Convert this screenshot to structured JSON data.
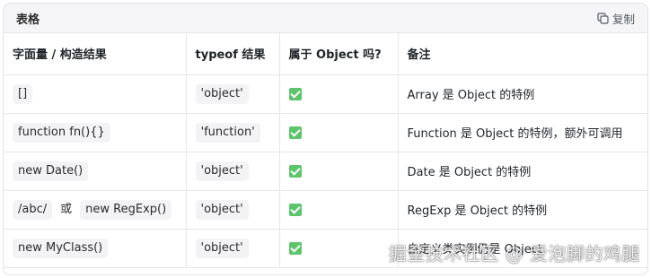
{
  "header": {
    "title": "表格",
    "copy_label": "复制",
    "copy_icon": "copy-icon"
  },
  "table": {
    "columns": [
      "字面量 / 构造结果",
      "typeof 结果",
      "属于 Object 吗?",
      "备注"
    ],
    "rows": [
      {
        "literal": "[]",
        "typeof": "'object'",
        "is_object": true,
        "note": "Array 是 Object 的特例"
      },
      {
        "literal": "function fn(){}",
        "typeof": "'function'",
        "is_object": true,
        "note": "Function 是 Object 的特例，额外可调用"
      },
      {
        "literal": "new Date()",
        "typeof": "'object'",
        "is_object": true,
        "note": "Date 是 Object 的特例"
      },
      {
        "literal": "/abc/",
        "literal_or": "或",
        "literal_alt": "new RegExp()",
        "typeof": "'object'",
        "is_object": true,
        "note": "RegExp 是 Object 的特例"
      },
      {
        "literal": "new MyClass()",
        "typeof": "'object'",
        "is_object": true,
        "note": "自定义类实例仍是 Object"
      }
    ],
    "check_icon": "check-mark-icon",
    "check_color": "#5cc46b"
  },
  "watermark": "掘金技术社区 @ 爱泡脚的鸡腿"
}
